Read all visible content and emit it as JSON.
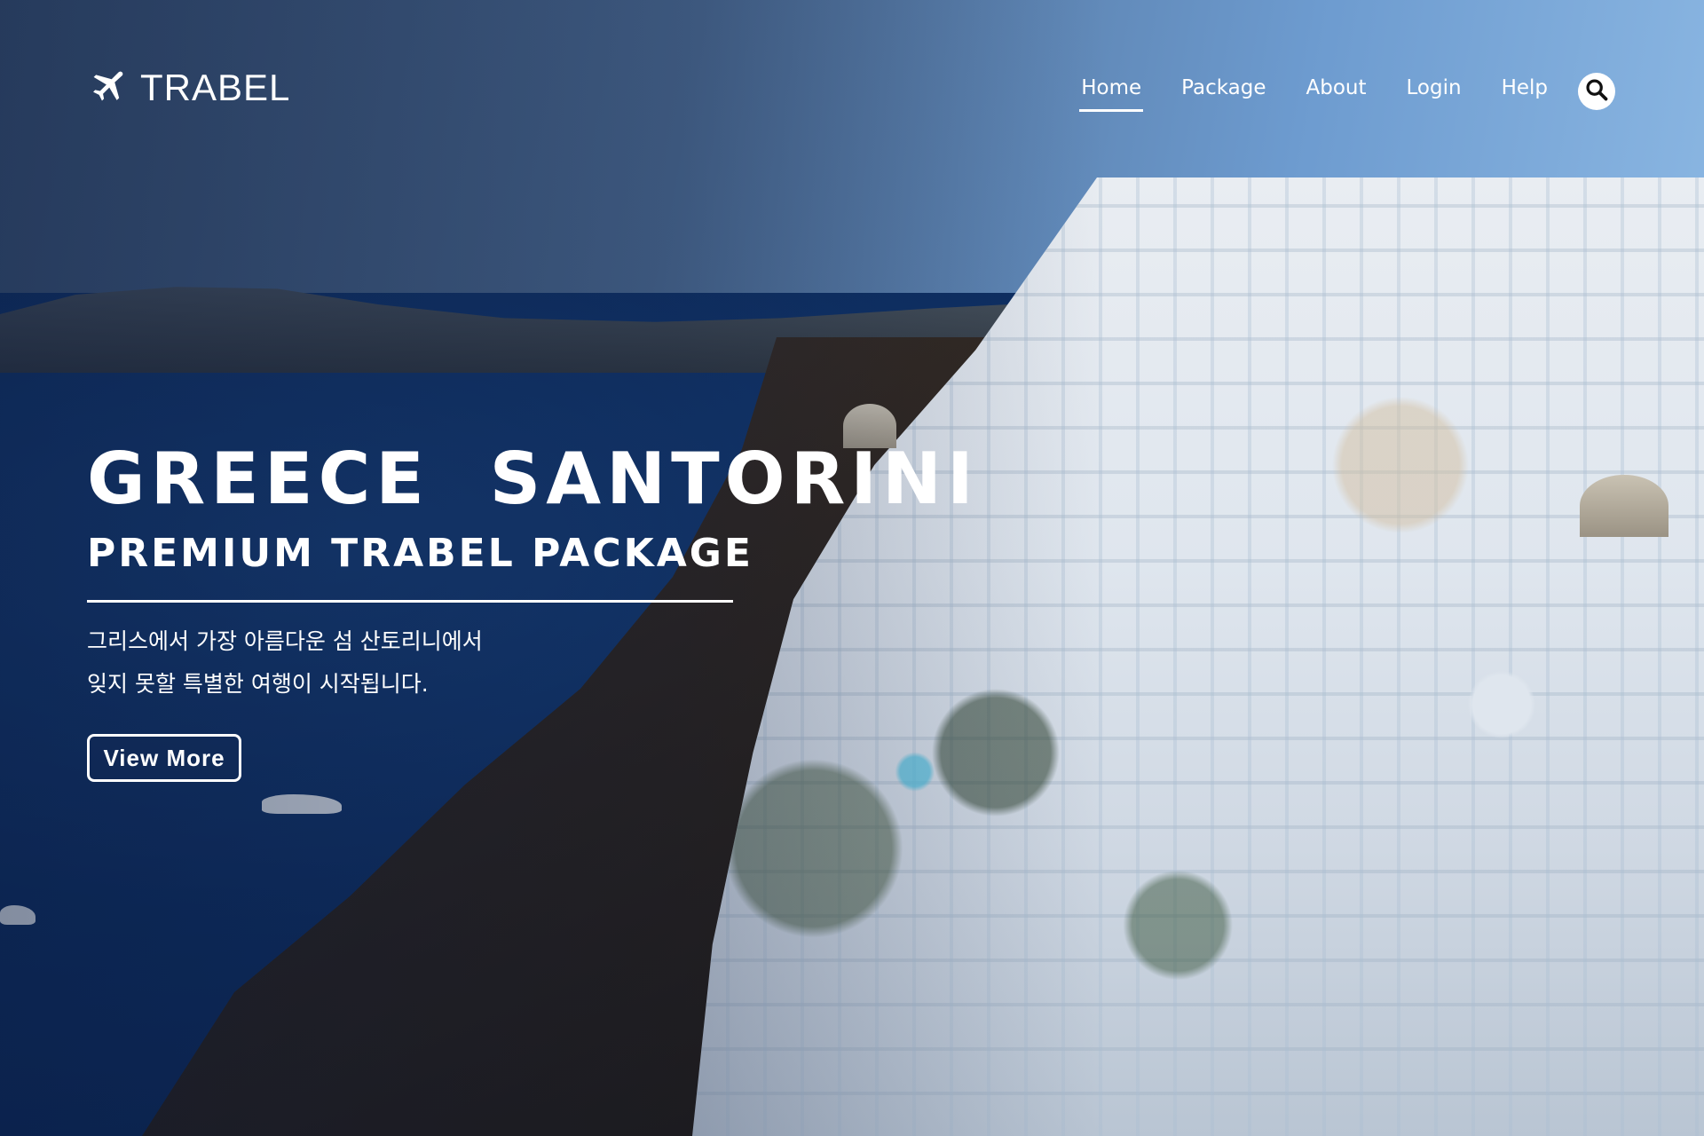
{
  "brand": {
    "name": "TRABEL",
    "logo_icon": "airplane-icon"
  },
  "nav": {
    "items": [
      {
        "label": "Home",
        "active": true
      },
      {
        "label": "Package",
        "active": false
      },
      {
        "label": "About",
        "active": false
      },
      {
        "label": "Login",
        "active": false
      },
      {
        "label": "Help",
        "active": false
      }
    ],
    "search_icon": "search-icon"
  },
  "hero": {
    "title": "GREECE  SANTORINI",
    "subtitle": "PREMIUM TRABEL PACKAGE",
    "description_line1": "그리스에서 가장 아름다운 섬 산토리니에서",
    "description_line2": "잊지 못할 특별한 여행이 시작됩니다.",
    "cta_label": "View More"
  },
  "colors": {
    "text": "#ffffff",
    "sea": "#0e2f63",
    "sky": "#6d9bcf"
  }
}
